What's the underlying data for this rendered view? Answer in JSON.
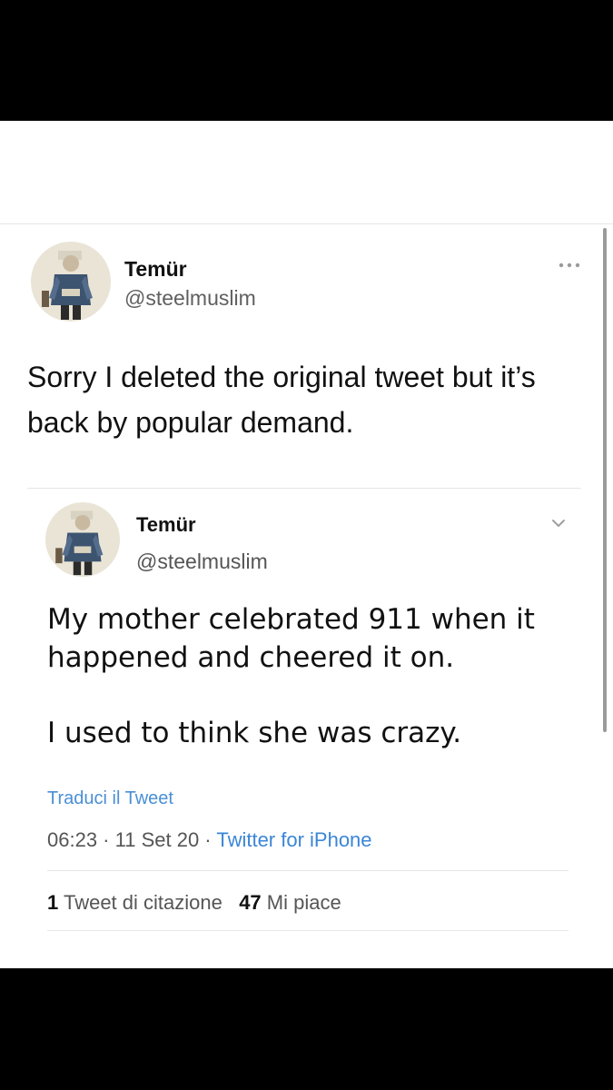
{
  "tweet": {
    "author_name": "Temür",
    "author_handle": "@steelmuslim",
    "text": "Sorry I deleted the original tweet but it’s back by popular demand."
  },
  "quoted_tweet": {
    "author_name": "Temür",
    "author_handle": "@steelmuslim",
    "text_line1": "My mother celebrated 911 when it happened and cheered it on.",
    "text_line2": "I used to think she was crazy.",
    "translate_label": "Traduci il Tweet",
    "time": "06:23",
    "date": "11 Set 20",
    "separator": " · ",
    "source": "Twitter for iPhone",
    "quote_count": "1",
    "quote_label": "Tweet di citazione",
    "like_count": "47",
    "like_label": "Mi piace"
  },
  "icons": {
    "more": "more-horizontal-icon",
    "chevron": "chevron-down-icon"
  },
  "colors": {
    "link": "#3b86d6",
    "text": "#111111",
    "secondary": "#555555",
    "divider": "#e6e6e6"
  }
}
